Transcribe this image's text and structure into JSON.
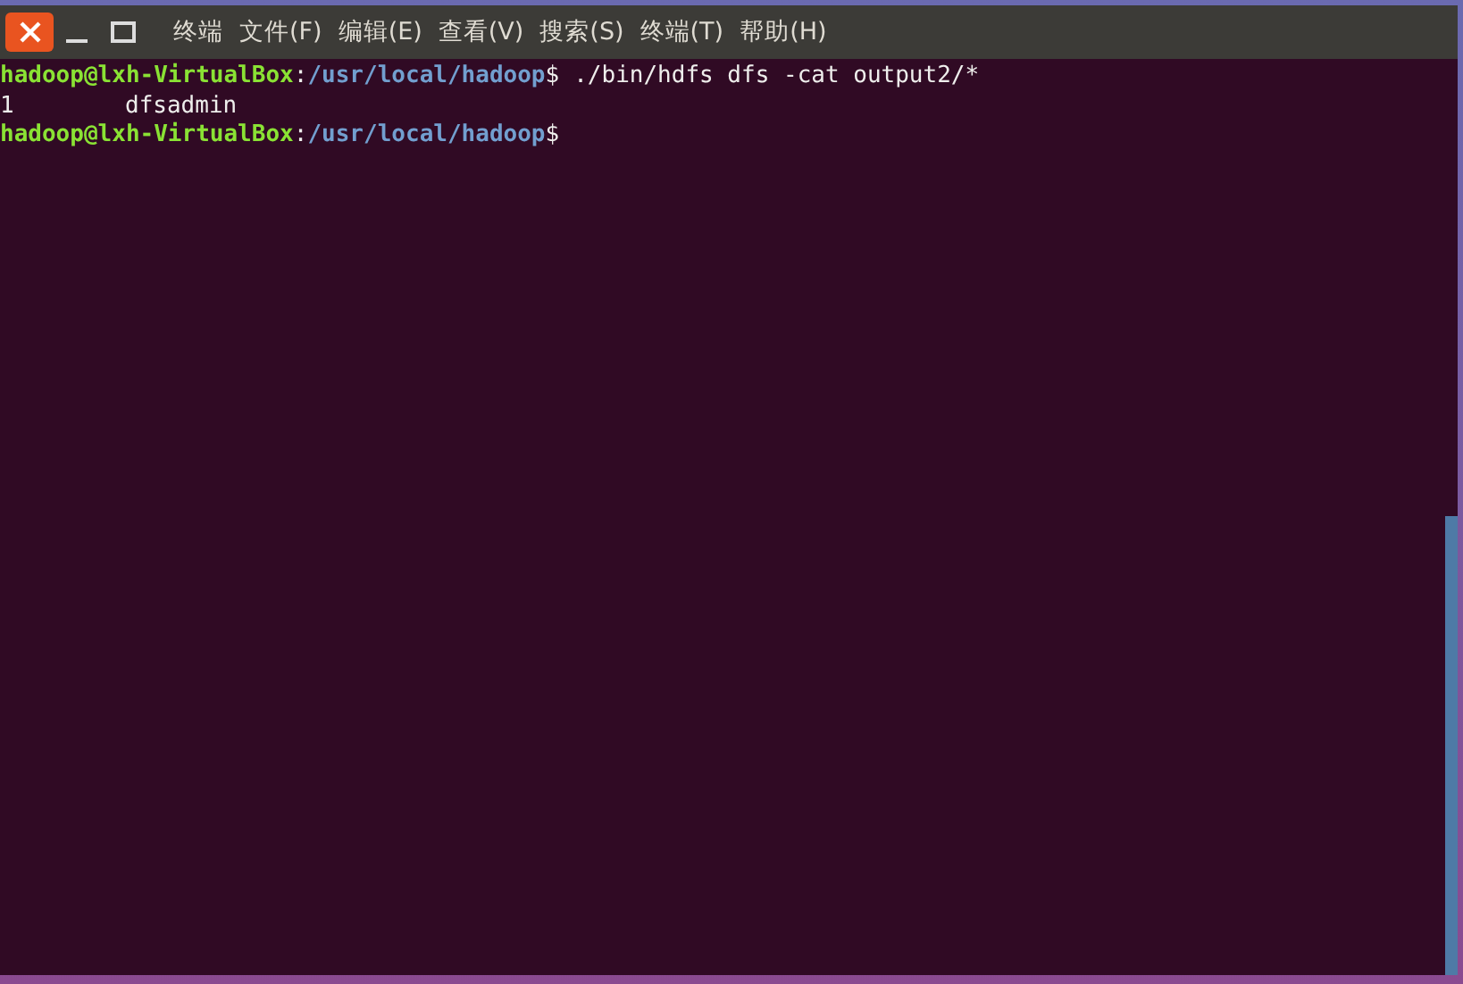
{
  "window": {
    "menu": [
      "终端",
      "文件(F)",
      "编辑(E)",
      "查看(V)",
      "搜索(S)",
      "终端(T)",
      "帮助(H)"
    ]
  },
  "terminal": {
    "lines": [
      {
        "kind": "prompt",
        "user": "hadoop@lxh-VirtualBox",
        "sep": ":",
        "path": "/usr/local/hadoop",
        "symbol": "$",
        "command": "./bin/hdfs dfs -cat output2/*"
      },
      {
        "kind": "output",
        "columns": [
          "1",
          "dfsadmin"
        ]
      },
      {
        "kind": "prompt",
        "user": "hadoop@lxh-VirtualBox",
        "sep": ":",
        "path": "/usr/local/hadoop",
        "symbol": "$"
      }
    ]
  }
}
